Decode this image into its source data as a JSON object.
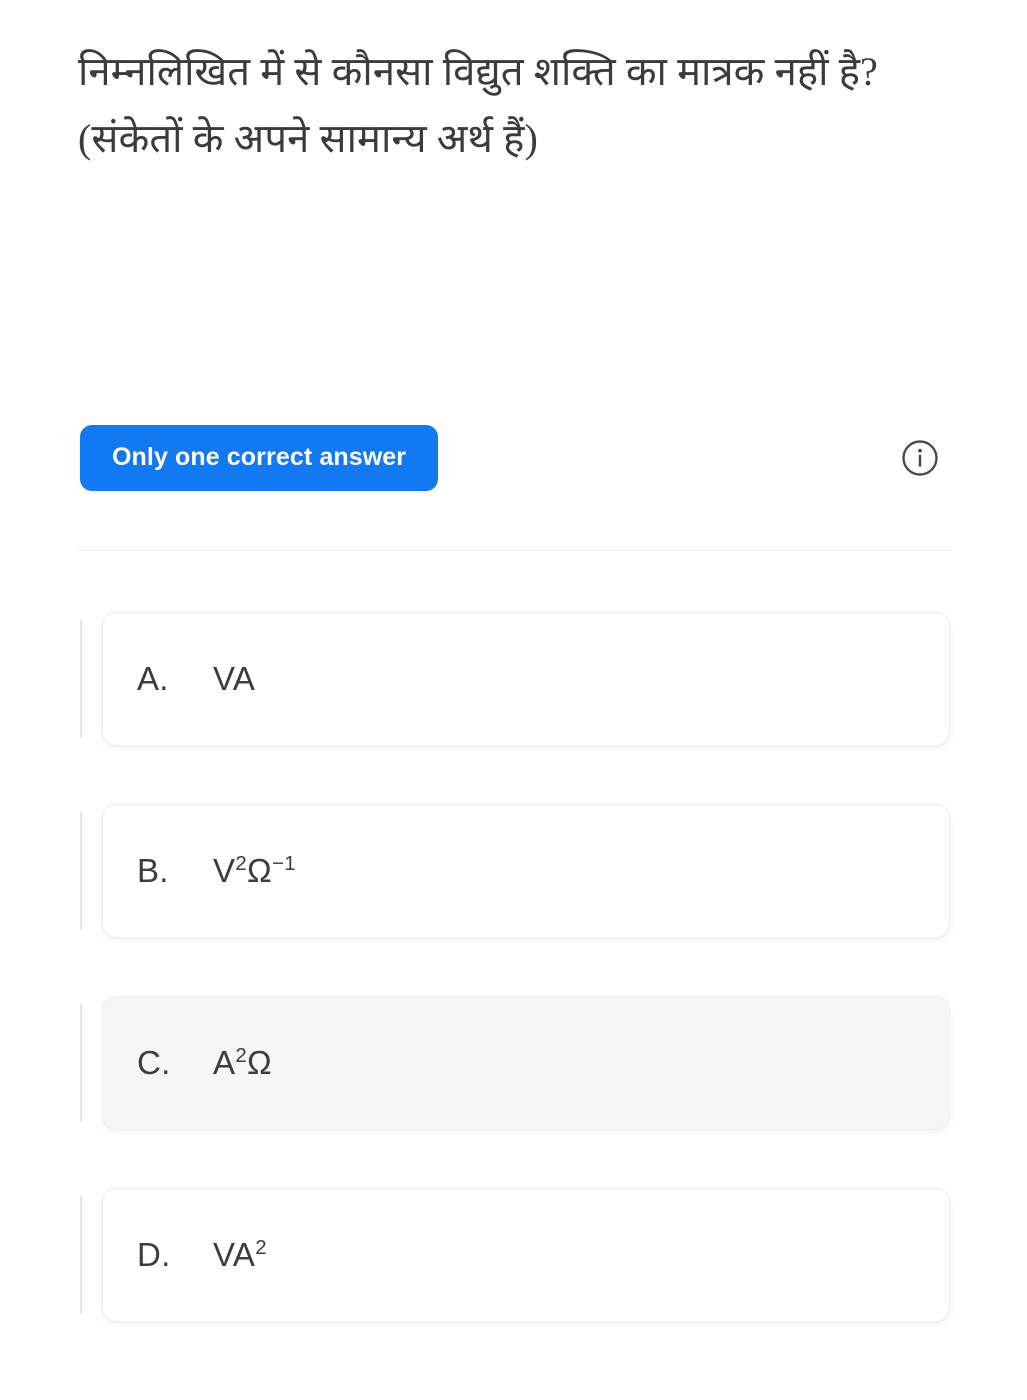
{
  "question": {
    "text": "निम्नलिखित में से कौनसा विद्युत शक्ति का मात्रक नहीं है? (संकेतों के अपने सामान्य अर्थ हैं)"
  },
  "meta": {
    "answer_mode_label": "Only one correct answer",
    "info_icon": "info-circle-icon",
    "accent_color": "#1279f2"
  },
  "options": [
    {
      "letter": "A.",
      "base": "VA",
      "sup1": "",
      "mid": "",
      "sup2": "",
      "display": "VA",
      "shaded": false
    },
    {
      "letter": "B.",
      "base": "V",
      "sup1": "2",
      "mid": "Ω",
      "sup2": "−1",
      "display": "V2Ω−1",
      "shaded": false
    },
    {
      "letter": "C.",
      "base": "A",
      "sup1": "2",
      "mid": "Ω",
      "sup2": "",
      "display": "A2Ω",
      "shaded": true
    },
    {
      "letter": "D.",
      "base": "VA",
      "sup1": "2",
      "mid": "",
      "sup2": "",
      "display": "VA2",
      "shaded": false
    }
  ]
}
